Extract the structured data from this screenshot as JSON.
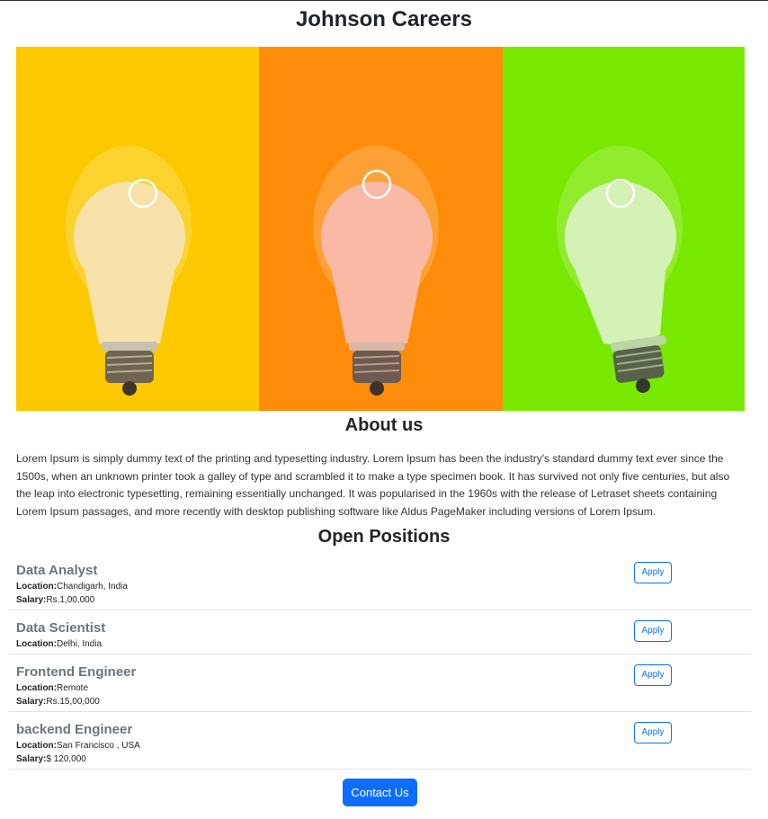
{
  "header": {
    "title": "Johnson Careers"
  },
  "hero": {
    "panels": [
      {
        "bg": "#fcc900",
        "bulb": "#f6e2a8"
      },
      {
        "bg": "#fd8c0a",
        "bulb": "#f9b9a4"
      },
      {
        "bg": "#79e800",
        "bulb": "#d4f2b5"
      }
    ]
  },
  "about": {
    "title": "About us",
    "text": "Lorem Ipsum is simply dummy text of the printing and typesetting industry. Lorem Ipsum has been the industry's standard dummy text ever since the 1500s, when an unknown printer took a galley of type and scrambled it to make a type specimen book. It has survived not only five centuries, but also the leap into electronic typesetting, remaining essentially unchanged. It was popularised in the 1960s with the release of Letraset sheets containing Lorem Ipsum passages, and more recently with desktop publishing software like Aldus PageMaker including versions of Lorem Ipsum."
  },
  "positions": {
    "title": "Open Positions",
    "location_label": "Location:",
    "salary_label": "Salary:",
    "apply_label": "Apply",
    "jobs": [
      {
        "title": "Data Analyst",
        "location": "Chandigarh, India",
        "salary": "Rs.1,00,000"
      },
      {
        "title": "Data Scientist",
        "location": "Delhi, India"
      },
      {
        "title": "Frontend Engineer",
        "location": "Remote",
        "salary": "Rs.15,00,000"
      },
      {
        "title": "backend Engineer",
        "location": "San Francisco , USA",
        "salary": "$ 120,000"
      }
    ]
  },
  "contact": {
    "label": "Contact Us"
  },
  "colors": {
    "primary": "#0d6efd",
    "job_title": "#6c757d"
  }
}
